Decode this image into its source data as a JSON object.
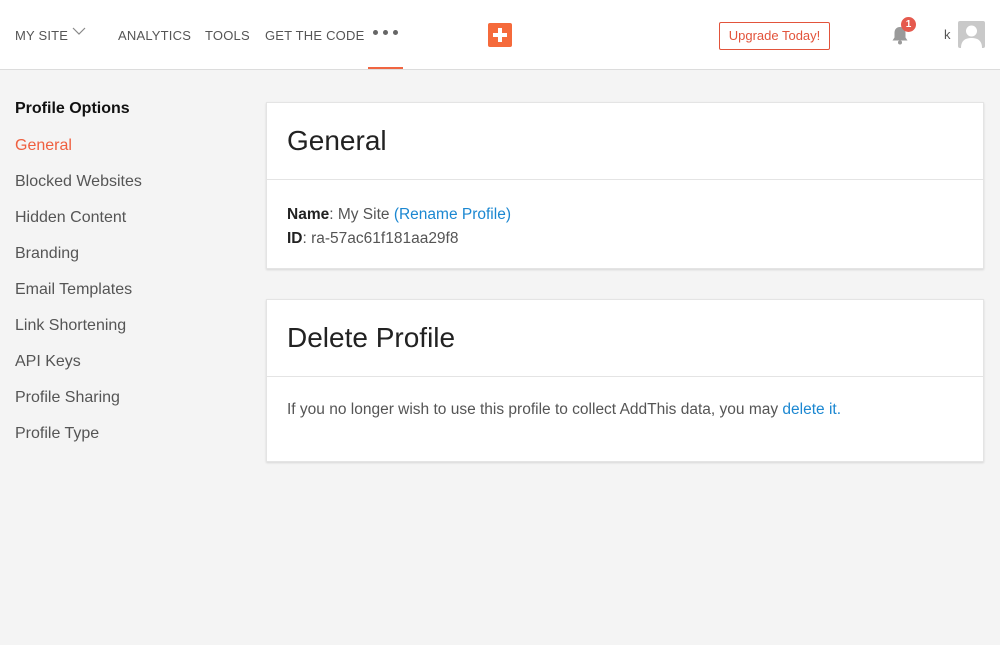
{
  "header": {
    "site_label": "MY SITE",
    "nav": [
      "ANALYTICS",
      "TOOLS",
      "GET THE CODE"
    ],
    "upgrade_label": "Upgrade Today!",
    "notification_count": "1",
    "user_initial": "k",
    "accent_color": "#f06541"
  },
  "sidebar": {
    "title": "Profile Options",
    "items": [
      {
        "label": "General",
        "active": true
      },
      {
        "label": "Blocked Websites"
      },
      {
        "label": "Hidden Content"
      },
      {
        "label": "Branding"
      },
      {
        "label": "Email Templates"
      },
      {
        "label": "Link Shortening"
      },
      {
        "label": "API Keys"
      },
      {
        "label": "Profile Sharing"
      },
      {
        "label": "Profile Type"
      }
    ]
  },
  "general_card": {
    "title": "General",
    "name_label": "Name",
    "name_value": ": My Site",
    "rename_link": "(Rename Profile)",
    "id_label": "ID",
    "id_value": ": ra-57ac61f181aa29f8"
  },
  "delete_card": {
    "title": "Delete Profile",
    "text": "If you no longer wish to use this profile to collect AddThis data, you may",
    "link": "delete it."
  }
}
